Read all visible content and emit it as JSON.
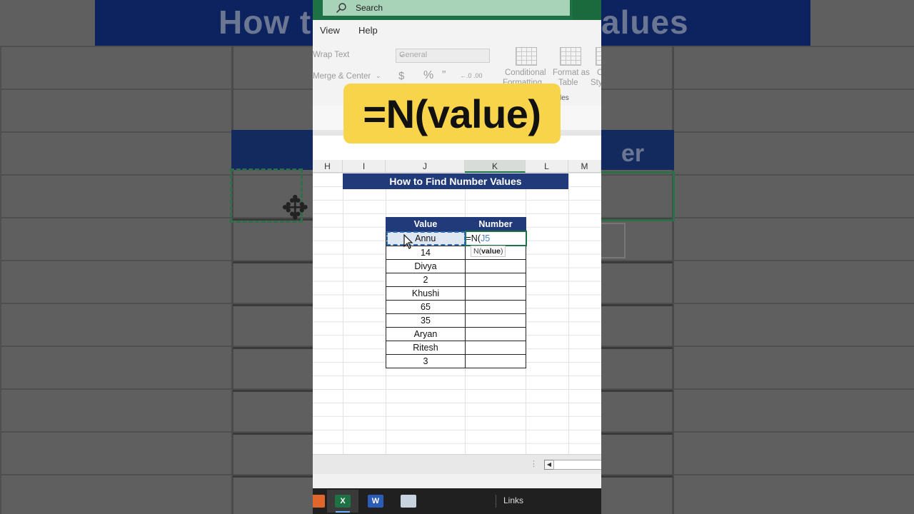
{
  "background": {
    "banner_left": "How to",
    "banner_right": "alues",
    "header_right": "er"
  },
  "titlebar": {
    "search_label": "Search"
  },
  "menu": {
    "items": [
      "View",
      "Help"
    ]
  },
  "ribbon": {
    "wrap_text": "Wrap Text",
    "merge_center": "Merge & Center",
    "number_format": "General",
    "currency_symbol": "$",
    "percent_symbol": "%",
    "comma_symbol": "”",
    "decimal_symbols": "←.0  .00",
    "conditional_formatting": "Conditional",
    "conditional_formatting_2": "Formatting",
    "format_as_table": "Format as",
    "format_as_table_2": "Table",
    "cell_styles": "C",
    "cell_styles_2": "Sty",
    "styles_group": "les"
  },
  "overlay": {
    "text": "=N(value)"
  },
  "columns": [
    "H",
    "I",
    "J",
    "K",
    "L",
    "M"
  ],
  "sheet": {
    "title": "How to Find Number Values",
    "headers": {
      "value": "Value",
      "number": "Number"
    },
    "rows": [
      {
        "value": "Annu",
        "number": ""
      },
      {
        "value": "14",
        "number": ""
      },
      {
        "value": "Divya",
        "number": ""
      },
      {
        "value": "2",
        "number": ""
      },
      {
        "value": "Khushi",
        "number": ""
      },
      {
        "value": "65",
        "number": ""
      },
      {
        "value": "35",
        "number": ""
      },
      {
        "value": "Aryan",
        "number": ""
      },
      {
        "value": "Ritesh",
        "number": ""
      },
      {
        "value": "3",
        "number": ""
      }
    ],
    "editing_formula": "=N(",
    "editing_ref": "J5",
    "tooltip_fn": "N(",
    "tooltip_arg": "value",
    "tooltip_close": ")"
  },
  "taskbar": {
    "links_label": "Links",
    "apps": [
      "excel-icon",
      "word-icon",
      "file-explorer-icon"
    ]
  },
  "colors": {
    "excel_green": "#1e7145",
    "table_header_navy": "#203a7a",
    "overlay_yellow": "#f8d44a"
  }
}
